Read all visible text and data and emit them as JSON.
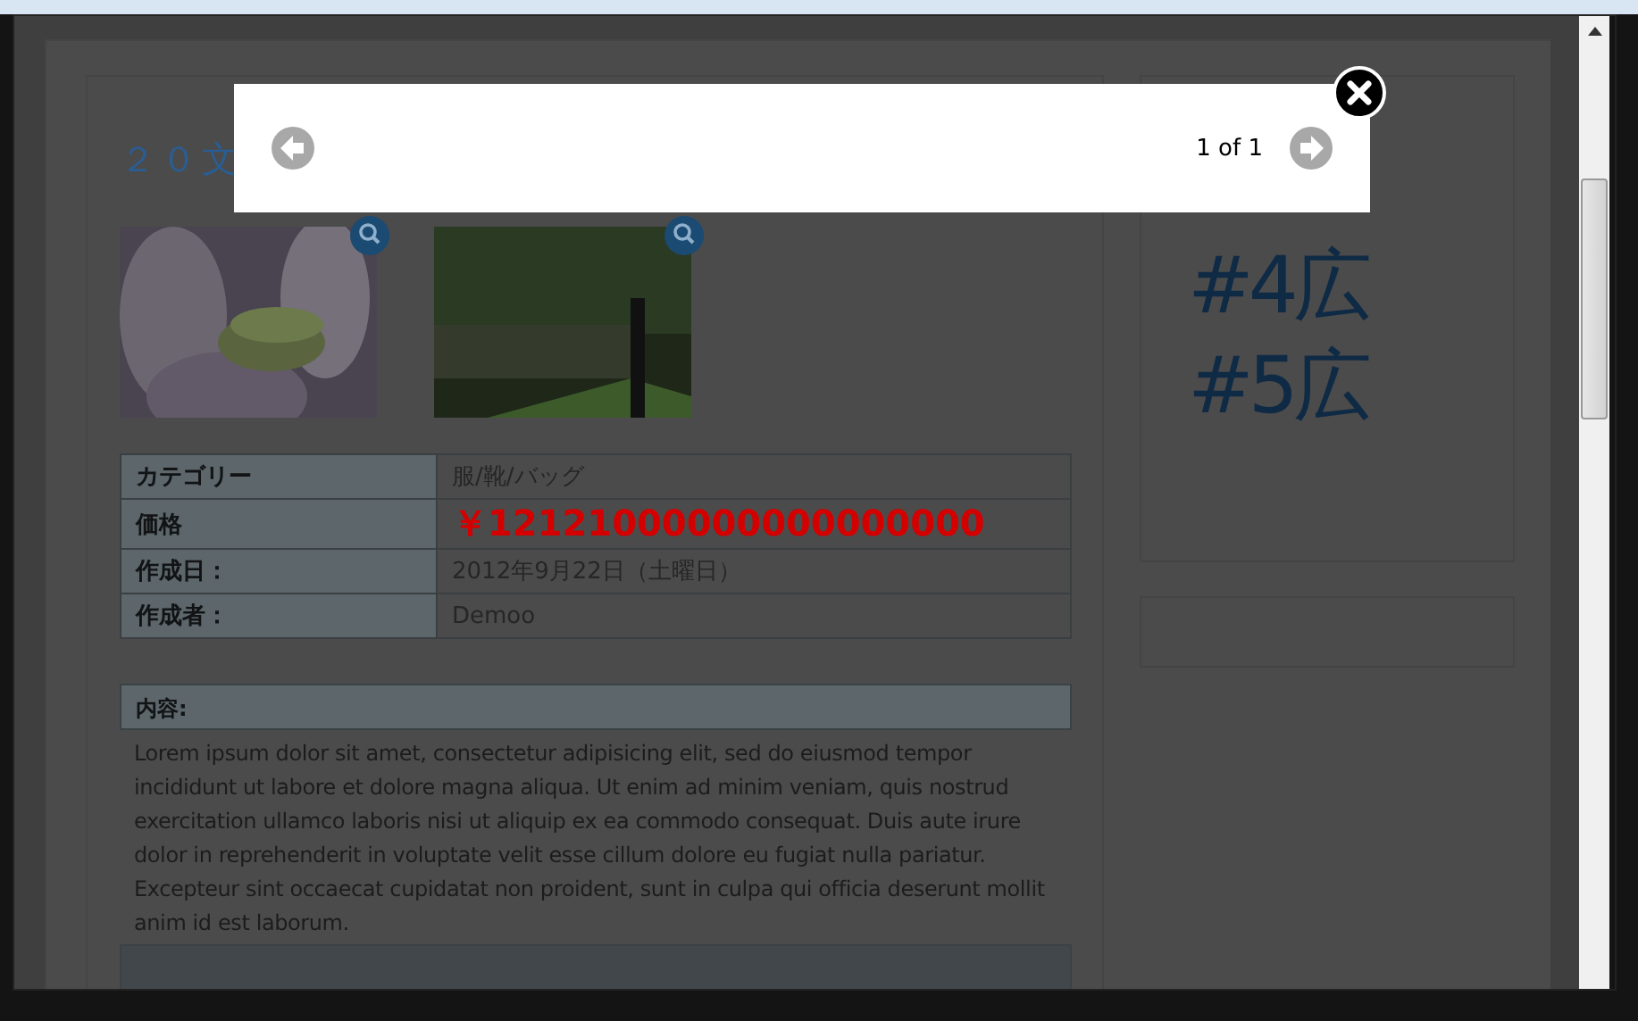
{
  "lightbox": {
    "counter": "1 of 1"
  },
  "item": {
    "title": "２０文",
    "details": [
      {
        "label": "カテゴリー",
        "value": "服/靴/バッグ",
        "kind": "text"
      },
      {
        "label": "価格",
        "value": "￥12121000000000000000",
        "kind": "price"
      },
      {
        "label": "作成日：",
        "value": "2012年9月22日（土曜日）",
        "kind": "text"
      },
      {
        "label": "作成者：",
        "value": "Demoo",
        "kind": "text"
      }
    ],
    "content_heading": "内容:",
    "content": "Lorem ipsum dolor sit amet, consectetur adipisicing elit, sed do eiusmod tempor incididunt ut labore et dolore magna aliqua. Ut enim ad minim veniam, quis nostrud exercitation ullamco laboris nisi ut aliquip ex ea commodo consequat. Duis aute irure dolor in reprehenderit in voluptate velit esse cillum dolore eu fugiat nulla pariatur. Excepteur sint occaecat cupidatat non proident, sunt in culpa qui officia deserunt mollit anim id est laborum."
  },
  "sidebar": {
    "ad_lines": [
      "#4広",
      "#5広"
    ]
  }
}
